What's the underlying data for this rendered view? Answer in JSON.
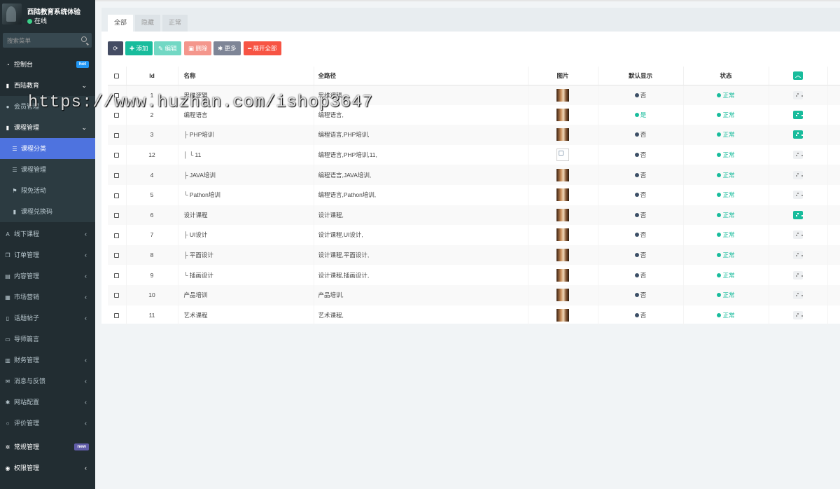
{
  "brand": {
    "name": "西陆教育系统体验",
    "status": "在线"
  },
  "search": {
    "placeholder": "搜索菜单"
  },
  "sidebar": {
    "items": [
      {
        "label": "控制台",
        "icon": "dashboard-icon",
        "badge": "hot"
      },
      {
        "label": "西陆教育",
        "icon": "book-icon",
        "arrow": "⌄"
      },
      {
        "label": "会员管理",
        "icon": "user-icon"
      },
      {
        "label": "课程管理",
        "icon": "book-icon",
        "arrow": "⌄"
      },
      {
        "label": "课程分类",
        "icon": "list-icon"
      },
      {
        "label": "课程管理",
        "icon": "list-icon"
      },
      {
        "label": "限免活动",
        "icon": "flag-icon"
      },
      {
        "label": "课程兑换码",
        "icon": "bookmark-icon"
      },
      {
        "label": "线下课程",
        "icon": "font-icon",
        "arrow": "‹"
      },
      {
        "label": "订单管理",
        "icon": "copy-icon",
        "arrow": "‹"
      },
      {
        "label": "内容管理",
        "icon": "list-alt-icon",
        "arrow": "‹"
      },
      {
        "label": "市场营销",
        "icon": "newspaper-icon",
        "arrow": "‹"
      },
      {
        "label": "话题帖子",
        "icon": "file-icon",
        "arrow": "‹"
      },
      {
        "label": "导师篇言",
        "icon": "calendar-icon"
      },
      {
        "label": "财务管理",
        "icon": "bank-icon",
        "arrow": "‹"
      },
      {
        "label": "消息与反馈",
        "icon": "envelope-icon",
        "arrow": "‹"
      },
      {
        "label": "网站配置",
        "icon": "gear-icon",
        "arrow": "‹"
      },
      {
        "label": "评价管理",
        "icon": "circle-icon",
        "arrow": "‹"
      },
      {
        "label": "常规管理",
        "icon": "cogs-icon",
        "badge": "new"
      },
      {
        "label": "权限管理",
        "icon": "group-icon",
        "arrow": "‹"
      }
    ]
  },
  "watermark": "https://www.huzhan.com/ishop3647",
  "tabs": [
    "全部",
    "隐藏",
    "正常"
  ],
  "toolbar": {
    "refresh": "⟳",
    "add": "添加",
    "edit": "编辑",
    "delete": "删除",
    "more": "更多",
    "expand": "展开全部"
  },
  "table": {
    "headers": {
      "id": "Id",
      "name": "名称",
      "path": "全路径",
      "image": "图片",
      "show": "默认显示",
      "status": "状态"
    },
    "rows": [
      {
        "id": "1",
        "name": "思维逻辑",
        "path": "思维逻辑,",
        "img": "photo",
        "show": "否",
        "status": "正常",
        "op": "off"
      },
      {
        "id": "2",
        "name": "编程语言",
        "path": "编程语言,",
        "img": "photo",
        "show": "是",
        "status": "正常",
        "op": "on"
      },
      {
        "id": "3",
        "name": "├ PHP培训",
        "path": "编程语言,PHP培训,",
        "img": "photo",
        "show": "否",
        "status": "正常",
        "op": "on"
      },
      {
        "id": "12",
        "name": "│ └ 11",
        "path": "编程语言,PHP培训,11,",
        "img": "broken",
        "show": "否",
        "status": "正常",
        "op": "off"
      },
      {
        "id": "4",
        "name": "├ JAVA培训",
        "path": "编程语言,JAVA培训,",
        "img": "photo",
        "show": "否",
        "status": "正常",
        "op": "off"
      },
      {
        "id": "5",
        "name": "└ Pathon培训",
        "path": "编程语言,Pathon培训,",
        "img": "photo",
        "show": "否",
        "status": "正常",
        "op": "off"
      },
      {
        "id": "6",
        "name": "设计课程",
        "path": "设计课程,",
        "img": "photo",
        "show": "否",
        "status": "正常",
        "op": "on"
      },
      {
        "id": "7",
        "name": "├ UI设计",
        "path": "设计课程,UI设计,",
        "img": "photo",
        "show": "否",
        "status": "正常",
        "op": "off"
      },
      {
        "id": "8",
        "name": "├ 平面设计",
        "path": "设计课程,平面设计,",
        "img": "photo",
        "show": "否",
        "status": "正常",
        "op": "off"
      },
      {
        "id": "9",
        "name": "└ 插画设计",
        "path": "设计课程,插画设计,",
        "img": "photo",
        "show": "否",
        "status": "正常",
        "op": "off"
      },
      {
        "id": "10",
        "name": "产品培训",
        "path": "产品培训,",
        "img": "photo",
        "show": "否",
        "status": "正常",
        "op": "off"
      },
      {
        "id": "11",
        "name": "艺术课程",
        "path": "艺术课程,",
        "img": "photo",
        "show": "否",
        "status": "正常",
        "op": "off"
      }
    ]
  },
  "colors": {
    "sidebar": "#222d32",
    "active": "#4e73df",
    "success": "#18bc9c",
    "danger": "#f75444"
  }
}
